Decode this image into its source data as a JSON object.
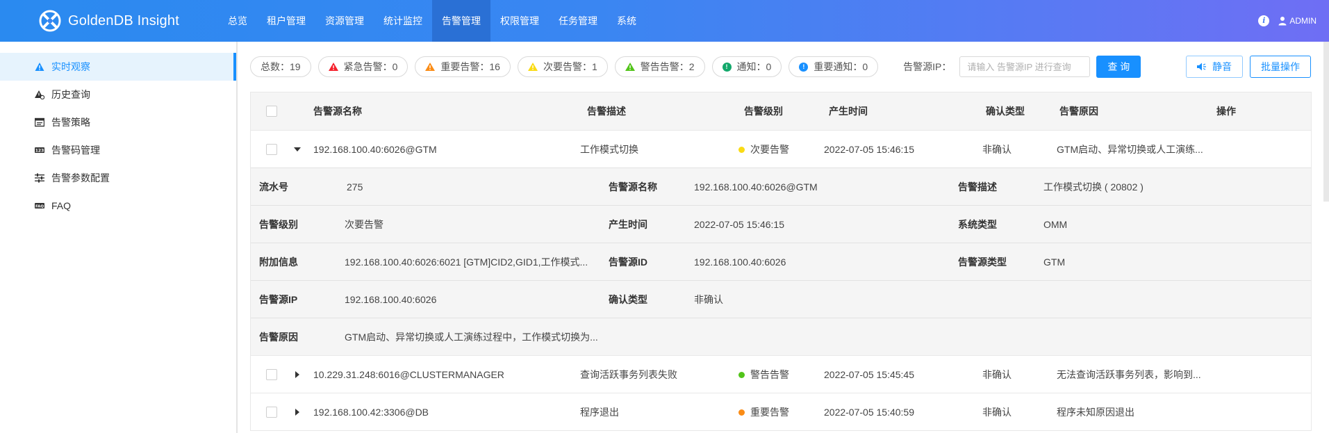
{
  "app": {
    "title": "GoldenDB Insight",
    "user": "ADMIN",
    "info_symbol": "i",
    "accent_color": "#1890ff"
  },
  "nav": [
    {
      "label": "总览",
      "active": false
    },
    {
      "label": "租户管理",
      "active": false
    },
    {
      "label": "资源管理",
      "active": false
    },
    {
      "label": "统计监控",
      "active": false
    },
    {
      "label": "告警管理",
      "active": true
    },
    {
      "label": "权限管理",
      "active": false
    },
    {
      "label": "任务管理",
      "active": false
    },
    {
      "label": "系统",
      "active": false
    }
  ],
  "sidebar": {
    "items": [
      {
        "label": "实时观察",
        "icon": "warning-triangle-icon",
        "active": true
      },
      {
        "label": "历史查询",
        "icon": "history-warning-icon",
        "active": false
      },
      {
        "label": "告警策略",
        "icon": "policy-window-icon",
        "active": false
      },
      {
        "label": "告警码管理",
        "icon": "code-123-icon",
        "active": false
      },
      {
        "label": "告警参数配置",
        "icon": "sliders-icon",
        "active": false
      },
      {
        "label": "FAQ",
        "icon": "faq-icon",
        "active": false
      }
    ]
  },
  "toolbar": {
    "filters": [
      {
        "label": "总数：19",
        "icon": "none",
        "color": ""
      },
      {
        "label": "紧急告警：0",
        "icon": "triangle",
        "color": "#f5222d"
      },
      {
        "label": "重要告警：16",
        "icon": "triangle",
        "color": "#fa8c16"
      },
      {
        "label": "次要告警：1",
        "icon": "triangle",
        "color": "#fadb14"
      },
      {
        "label": "警告告警：2",
        "icon": "triangle",
        "color": "#52c41a"
      },
      {
        "label": "通知：0",
        "icon": "circle",
        "color": "#13a86b"
      },
      {
        "label": "重要通知：0",
        "icon": "circle",
        "color": "#1890ff"
      }
    ],
    "source_ip_label": "告警源IP：",
    "source_ip_placeholder": "请输入 告警源IP 进行查询",
    "query_label": "查 询",
    "mute_label": "静音",
    "batch_label": "批量操作"
  },
  "table": {
    "columns": [
      "告警源名称",
      "告警描述",
      "告警级别",
      "产生时间",
      "确认类型",
      "告警原因",
      "操作"
    ],
    "rows": [
      {
        "source": "192.168.100.40:6026@GTM",
        "desc": "工作模式切换",
        "level": "次要告警",
        "level_color": "#fadb14",
        "time": "2022-07-05 15:46:15",
        "confirm": "非确认",
        "reason": "GTM启动、异常切换或人工演练...",
        "expanded": true
      },
      {
        "source": "10.229.31.248:6016@CLUSTERMANAGER",
        "desc": "查询活跃事务列表失败",
        "level": "警告告警",
        "level_color": "#52c41a",
        "time": "2022-07-05 15:45:45",
        "confirm": "非确认",
        "reason": "无法查询活跃事务列表，影响到...",
        "expanded": false
      },
      {
        "source": "192.168.100.42:3306@DB",
        "desc": "程序退出",
        "level": "重要告警",
        "level_color": "#fa8c16",
        "time": "2022-07-05 15:40:59",
        "confirm": "非确认",
        "reason": "程序未知原因退出",
        "expanded": false
      }
    ],
    "detail": {
      "serial_label": "流水号",
      "serial": "275",
      "src_name_label": "告警源名称",
      "src_name": "192.168.100.40:6026@GTM",
      "desc_label": "告警描述",
      "desc": "工作模式切换 ( 20802 )",
      "level_label": "告警级别",
      "level": "次要告警",
      "time_label": "产生时间",
      "time": "2022-07-05 15:46:15",
      "systype_label": "系统类型",
      "systype": "OMM",
      "extra_label": "附加信息",
      "extra": "192.168.100.40:6026:6021 [GTM]CID2,GID1,工作模式...",
      "src_id_label": "告警源ID",
      "src_id": "192.168.100.40:6026",
      "src_type_label": "告警源类型",
      "src_type": "GTM",
      "src_ip_label": "告警源IP",
      "src_ip": "192.168.100.40:6026",
      "confirm_label": "确认类型",
      "confirm": "非确认",
      "reason_label": "告警原因",
      "reason": "GTM启动、异常切换或人工演练过程中，工作模式切换为..."
    }
  }
}
